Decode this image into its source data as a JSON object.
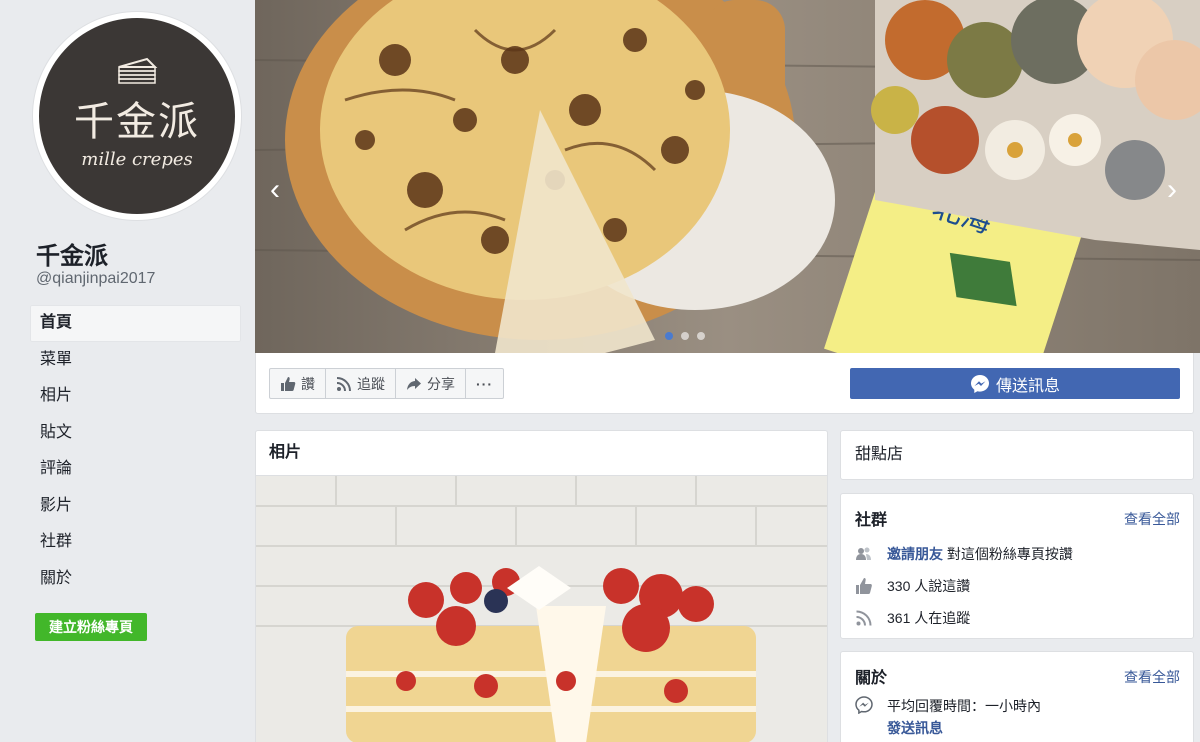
{
  "page": {
    "name": "千金派",
    "handle": "@qianjinpai2017",
    "logo_text_cn": "千金派",
    "logo_text_en": "mille crepes"
  },
  "sidebar": {
    "items": [
      {
        "label": "首頁",
        "active": true
      },
      {
        "label": "菜單"
      },
      {
        "label": "相片"
      },
      {
        "label": "貼文"
      },
      {
        "label": "評論"
      },
      {
        "label": "影片"
      },
      {
        "label": "社群"
      },
      {
        "label": "關於"
      }
    ],
    "create_page_label": "建立粉絲專頁"
  },
  "cover": {
    "prev_icon": "chevron-left-icon",
    "next_icon": "chevron-right-icon",
    "slide_count": 3,
    "active_slide": 1
  },
  "actions": {
    "like_label": "讚",
    "follow_label": "追蹤",
    "share_label": "分享",
    "more_label": "···",
    "send_message_label": "傳送訊息"
  },
  "photos": {
    "title": "相片"
  },
  "category": {
    "label": "甜點店"
  },
  "community": {
    "title": "社群",
    "see_all": "查看全部",
    "invite_link": "邀請朋友",
    "invite_text": " 對這個粉絲專頁按讚",
    "likes_text": "330 人說這讚",
    "follows_text": "361 人在追蹤"
  },
  "about": {
    "title": "關於",
    "see_all": "查看全部",
    "response_text": "平均回覆時間：一小時內",
    "send_message_link": "發送訊息"
  },
  "colors": {
    "brand_blue": "#4267b2",
    "link_blue": "#385898",
    "create_green": "#42b72a",
    "background": "#e9ebee"
  }
}
